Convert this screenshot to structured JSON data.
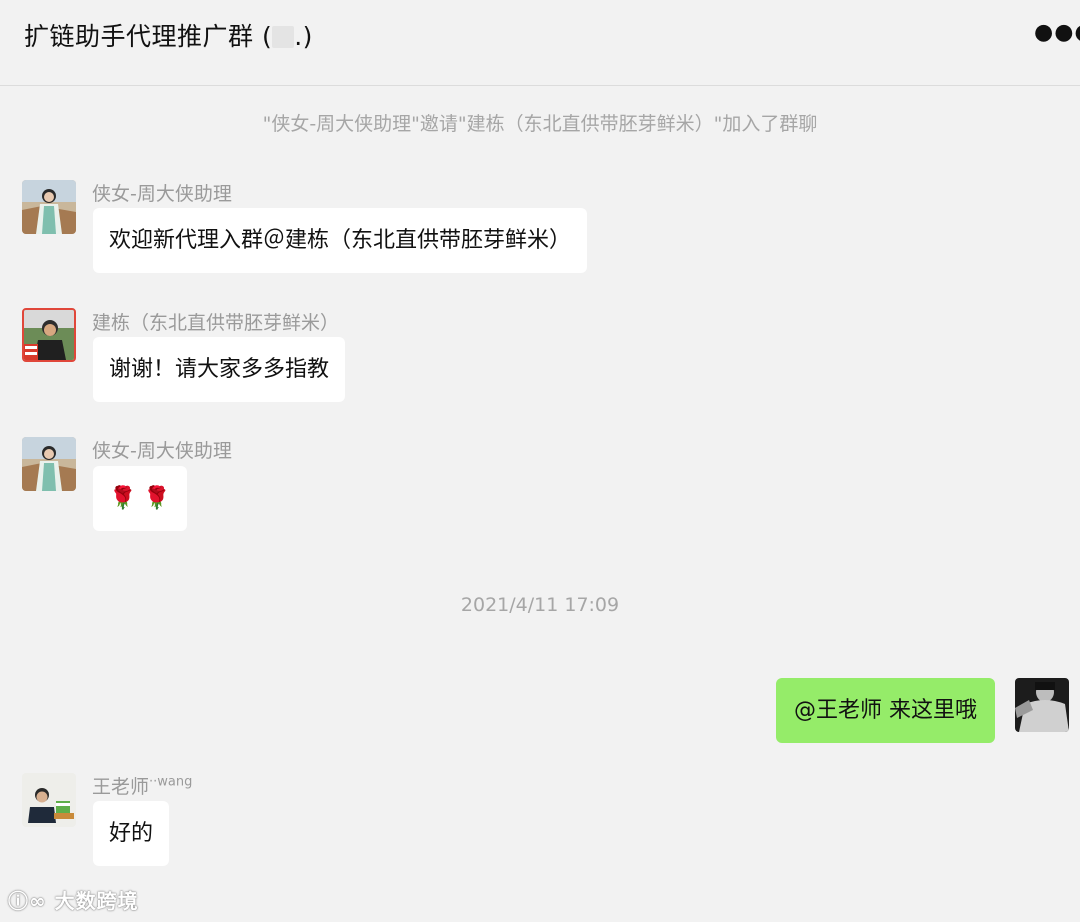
{
  "header": {
    "title_prefix": "扩链助手代理推广群 (",
    "title_suffix": ".)",
    "more_icon": "more-dots-icon"
  },
  "system_messages": {
    "invite": "\"侠女-周大侠助理\"邀请\"建栋（东北直供带胚芽鲜米）\"加入了群聊",
    "timestamp": "2021/4/11 17:09"
  },
  "messages": [
    {
      "sender": "侠女-周大侠助理",
      "text": "欢迎新代理入群＠建栋（东北直供带胚芽鲜米）"
    },
    {
      "sender": "建栋（东北直供带胚芽鲜米）",
      "text": "谢谢！请大家多多指教"
    },
    {
      "sender": "侠女-周大侠助理",
      "text": "🌹 🌹"
    },
    {
      "sender": "",
      "text": "@王老师 来这里哦",
      "mine": true
    },
    {
      "sender": "王老师",
      "sender_suffix": "wang",
      "text": "好的"
    }
  ],
  "watermark": "大数跨境",
  "colors": {
    "background": "#f2f2f2",
    "bubble_other": "#ffffff",
    "bubble_mine": "#95ec69",
    "system_text": "#a6a6a6"
  }
}
